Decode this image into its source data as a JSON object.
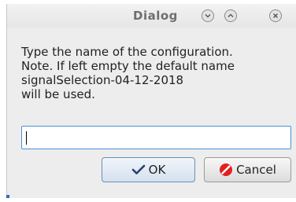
{
  "window": {
    "title": "Dialog",
    "controls": {
      "minimize_icon": "chevron-down-icon",
      "maximize_icon": "chevron-up-icon",
      "close_icon": "close-icon"
    }
  },
  "message": {
    "line1": "Type the name of the configuration.",
    "line2": "Note. If left empty the default name",
    "line3": "signalSelection-04-12-2018",
    "line4": "will be used."
  },
  "name_field": {
    "value": ""
  },
  "buttons": {
    "ok_label": "OK",
    "cancel_label": "Cancel"
  },
  "colors": {
    "focus_border": "#4a90d9",
    "cancel_icon": "#e02020",
    "ok_icon": "#2a3f6e"
  }
}
